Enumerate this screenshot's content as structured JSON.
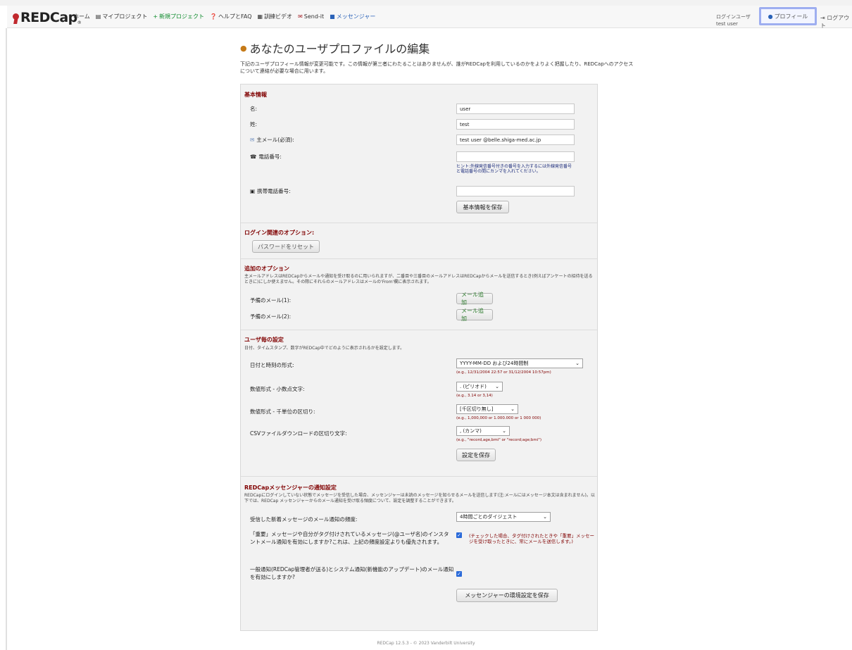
{
  "app": {
    "logo_text": "REDCap",
    "logo_reg": "®"
  },
  "nav": {
    "items": [
      {
        "label": "ホーム",
        "icon": "home"
      },
      {
        "label": "マイプロジェクト",
        "icon": "list-icon"
      },
      {
        "label": "新規プロジェクト",
        "icon": "plus-icon"
      },
      {
        "label": "ヘルプとFAQ",
        "icon": "question-circle-icon"
      },
      {
        "label": "訓練ビデオ",
        "icon": "film-icon"
      },
      {
        "label": "Send-it",
        "icon": "envelope-icon"
      },
      {
        "label": "メッセンジャー",
        "icon": "chat-icon"
      }
    ],
    "login_label": "ログインユーザ",
    "login_user": "test user",
    "profile_label": "プロフィール",
    "logout_label": "ログアウト"
  },
  "page": {
    "title": "あなたのユーザプロファイルの編集",
    "description": "下記のユーザプロフィール情報が変更可能です。この情報が第三者にわたることはありませんが、誰がREDCapを利用しているのかをよりよく把握したり、REDCapへのアクセスについて連絡が必要な場合に用います。"
  },
  "basic": {
    "title": "基本情報",
    "first_name_label": "名:",
    "first_name_value": "user",
    "last_name_label": "姓:",
    "last_name_value": "test",
    "email_label": "主メール(必須):",
    "email_value": "test user @belle.shiga-med.ac.jp",
    "phone_label": "電話番号:",
    "phone_value": "",
    "phone_hint": "ヒント:外線発信番号付きの番号を入力するには外線発信番号と電話番号の間にカンマを入れてください。",
    "mobile_label": "携帯電話番号:",
    "mobile_value": "",
    "save_label": "基本情報を保存"
  },
  "login_options": {
    "title": "ログイン関連のオプション:",
    "reset_password_label": "パスワードをリセット"
  },
  "additional": {
    "title": "追加のオプション",
    "description": "主メールアドレスはREDCapからメールや通知を受け取るのに用いられますが、二番目や三番目のメールアドレスはREDCapからメールを送信するとき(例えばアンケートの招待を送るときに)にしか使えません。その際にそれらのメールアドレスはメールの'From'欄に表示されます。",
    "email1_label": "予備のメール(1):",
    "email2_label": "予備のメール(2):",
    "add_email_label": "メール追加"
  },
  "prefs": {
    "title": "ユーザ毎の設定",
    "description": "日付、タイムスタンプ、数字がREDCap中でどのように表示されるかを設定します。",
    "datetime_label": "日付と時刻の形式:",
    "datetime_value": "YYYY-MM-DD および24時間制",
    "datetime_example": "(e.g., 12/31/2004 22:57 or 31/12/2004 10:57pm)",
    "decimal_label": "数値形式 - 小数点文字:",
    "decimal_value": ". (ピリオド)",
    "decimal_example": "(e.g., 3.14 or 3,14)",
    "thousands_label": "数値形式 - 千単位の区切り:",
    "thousands_value": "[千区切り無し]",
    "thousands_example": "(e.g., 1,000,000 or 1.000.000 or 1 000 000)",
    "csv_label": "CSVファイルダウンロードの区切り文字:",
    "csv_value": ", (カンマ)",
    "csv_example": "(e.g., \"record,age,bmi\" or \"record;age;bmi\")",
    "save_label": "設定を保存"
  },
  "messenger": {
    "title": "REDCapメッセンジャーの通知設定",
    "description": "REDCapにログインしていない状態でメッセージを受信した場合、メッセンジャーは未読のメッセージを知らせるメールを送信します(注:メールにはメッセージ本文は含まれません)。以下では、REDCap メッセンジャーからのメール通知を受け取る頻度について、設定を調整することができます。",
    "frequency_label": "受信した新着メッセージのメール通知の頻度:",
    "frequency_value": "4時間ごとのダイジェスト",
    "instant_label": "「重要」メッセージや自分がタグ付けされているメッセージ(@ユーザ名)のインスタントメール通知を有効にしますか?これは、上記の頻度設定よりも優先されます。",
    "instant_checked": true,
    "instant_note": "(チェックした場合、タグ付けされたときや「重要」メッセージを受け取ったときに、常にメールを送信します。)",
    "general_label": "一般通知(REDCap管理者が送る)とシステム通知(新機能のアップデート)のメール通知を有効にしますか?",
    "general_checked": true,
    "save_label": "メッセンジャーの環境設定を保存"
  },
  "footer": {
    "text": "REDCap 12.5.3 - © 2023 Vanderbilt University"
  }
}
